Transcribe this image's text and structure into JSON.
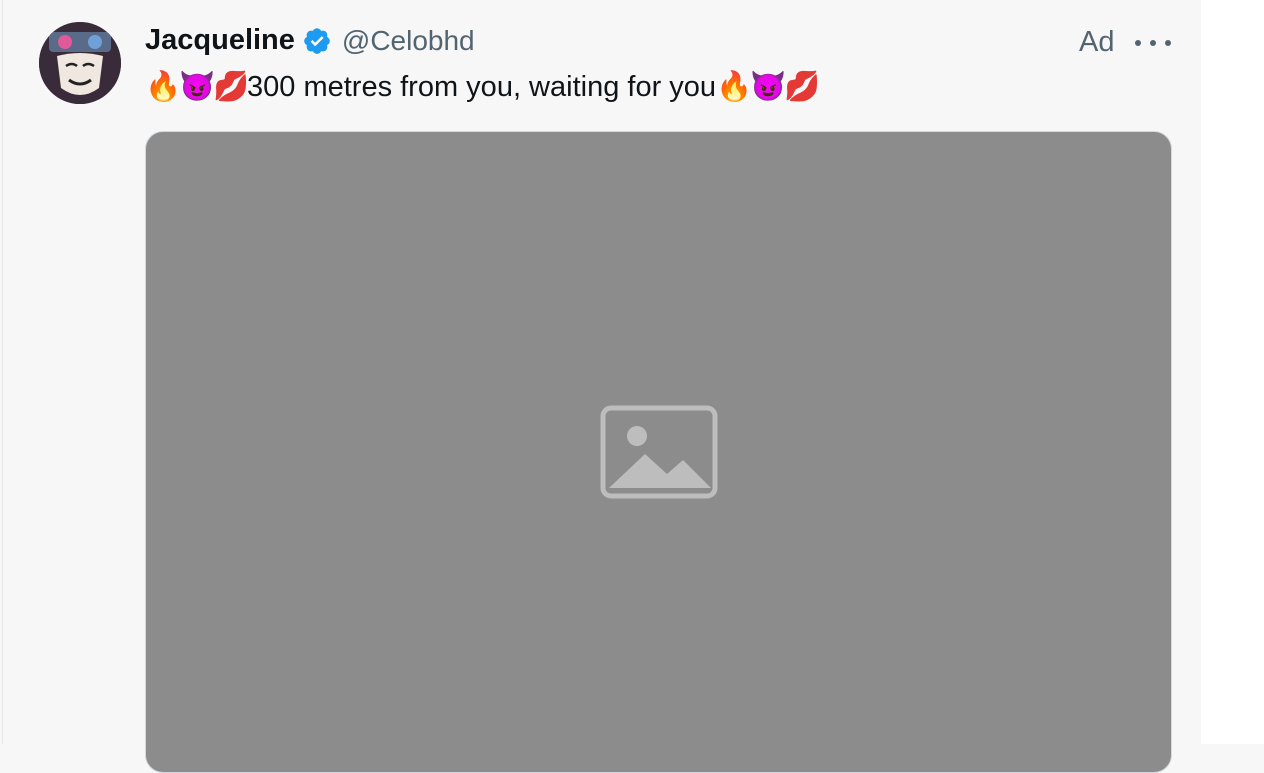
{
  "tweet": {
    "name": "Jacqueline",
    "handle": "@Celobhd",
    "ad_label": "Ad",
    "text_start_emojis": [
      "🔥",
      "😈",
      "💋"
    ],
    "text": "300 metres from you, waiting for you",
    "text_end_emojis": [
      "🔥",
      "😈",
      "💋"
    ]
  },
  "icons": {
    "verified": "verified-badge-icon",
    "more": "more-icon",
    "media": "image-placeholder-icon"
  },
  "colors": {
    "verified_blue": "#1d9bf0",
    "secondary_text": "#536471",
    "primary_text": "#0f1419"
  }
}
